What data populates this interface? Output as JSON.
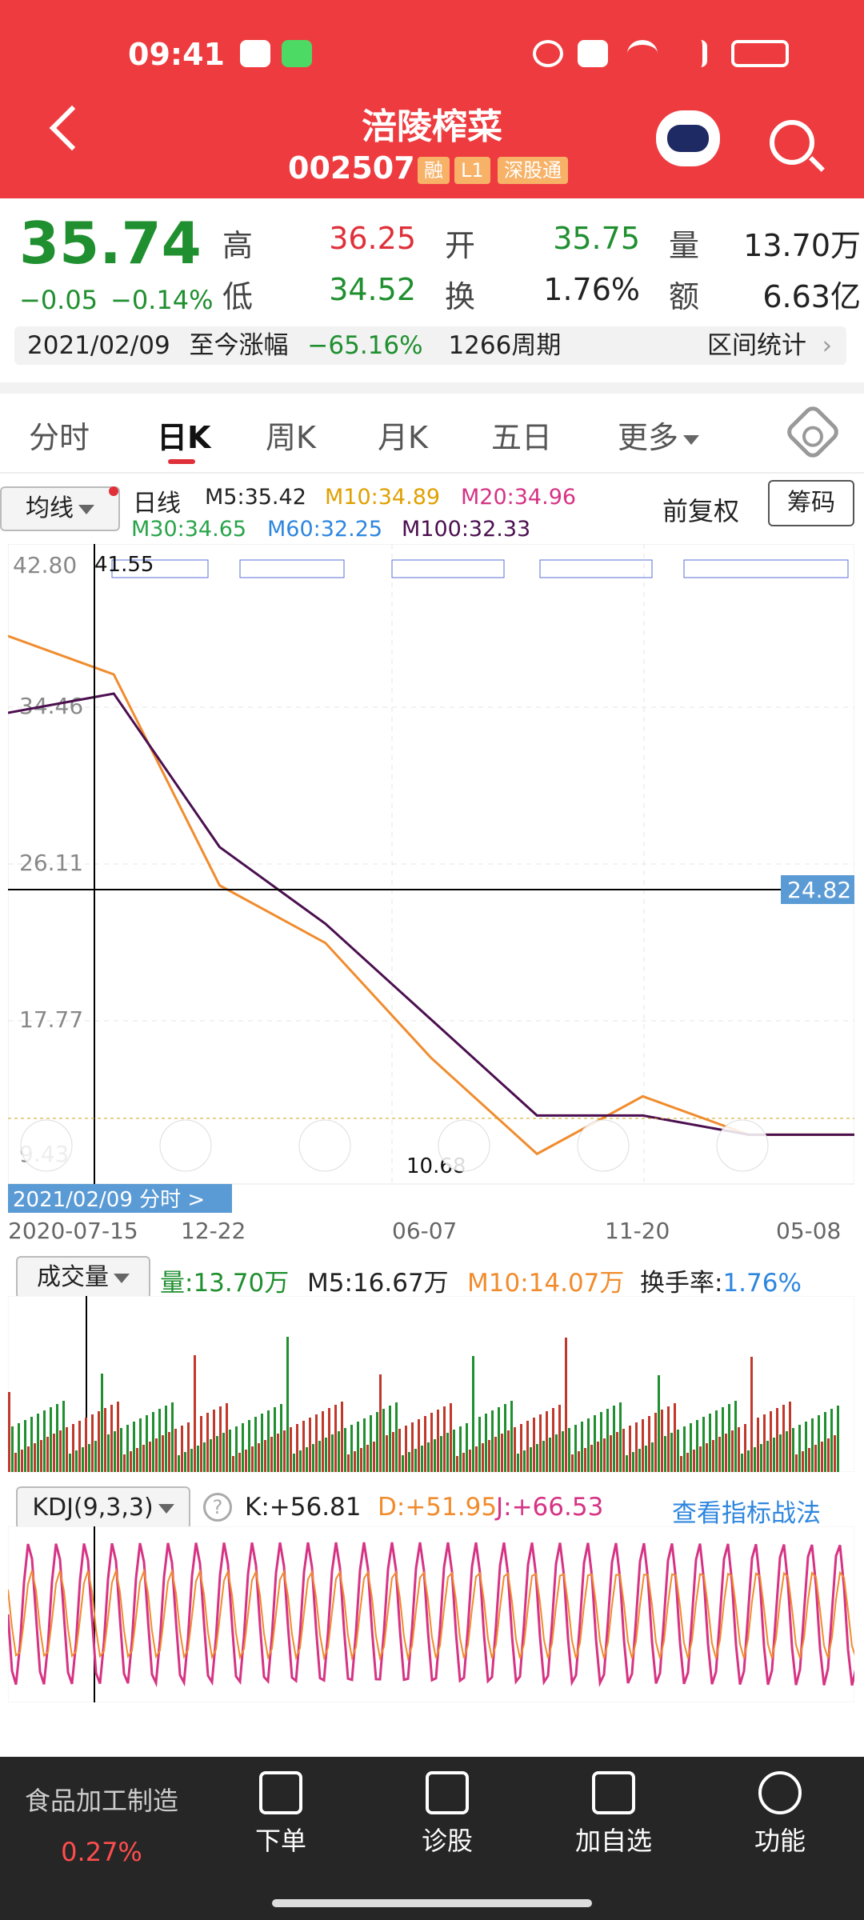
{
  "status": {
    "time": "09:41"
  },
  "header": {
    "title": "涪陵榨菜",
    "code": "002507",
    "tags": [
      "融",
      "L1",
      "深股通"
    ]
  },
  "quote": {
    "price": "35.74",
    "change": "−0.05",
    "change_pct": "−0.14%",
    "high_label": "高",
    "high": "36.25",
    "low_label": "低",
    "low": "34.52",
    "open_label": "开",
    "open": "35.75",
    "turnover_label": "换",
    "turnover": "1.76%",
    "volume_label": "量",
    "volume": "13.70万",
    "amount_label": "额",
    "amount": "6.63亿"
  },
  "range": {
    "date": "2021/02/09",
    "since_label": "至今涨幅",
    "since_value": "−65.16%",
    "periods": "1266周期",
    "stats_button": "区间统计"
  },
  "tabs": [
    "分时",
    "日K",
    "周K",
    "月K",
    "五日",
    "更多"
  ],
  "kline": {
    "ma_selector": "均线",
    "line_type": "日线",
    "ma": [
      "M5:35.42",
      "M10:34.89",
      "M20:34.96",
      "M30:34.65",
      "M60:32.25",
      "M100:32.33"
    ],
    "adjust": "前复权",
    "chips_button": "筹码",
    "y_ticks": [
      "42.80",
      "34.46",
      "26.11",
      "17.77",
      "9.43"
    ],
    "crosshair_price": "24.82",
    "max_label": "41.55",
    "min_label": "10.68",
    "date_tag": "2021/02/09  分时 >",
    "x_ticks": [
      "2020-07-15",
      "12-22",
      "06-07",
      "11-20",
      "05-08"
    ]
  },
  "volume": {
    "selector": "成交量",
    "vol": "量:13.70万",
    "m5": "M5:16.67万",
    "m10": "M10:14.07万",
    "turnover_label": "换手率:",
    "turnover": "1.76%"
  },
  "kdj": {
    "selector": "KDJ(9,3,3)",
    "k": "K:+56.81",
    "d": "D:+51.95",
    "j": "J:+66.53",
    "link": "查看指标战法"
  },
  "bottom": {
    "sector": "食品加工制造",
    "sector_pct": "0.27%",
    "items": [
      "下单",
      "诊股",
      "加自选",
      "功能"
    ]
  },
  "colors": {
    "red": "#ee3b3f",
    "green": "#1f8f2f",
    "orange": "#f08c2e",
    "pink": "#d63384",
    "blue": "#2e86de",
    "purple": "#4b0f4f"
  },
  "chart_data": {
    "type": "line",
    "title": "",
    "x": [
      "2020-07-15",
      "12-22",
      "06-07",
      "11-20",
      "05-08"
    ],
    "ylim": [
      9.43,
      42.8
    ],
    "series": [
      {
        "name": "M5",
        "values": [
          38,
          36,
          25,
          22,
          16,
          11,
          14,
          12,
          12
        ]
      },
      {
        "name": "M60",
        "values": [
          34,
          35,
          27,
          23,
          18,
          13,
          13,
          12,
          12
        ]
      }
    ]
  }
}
